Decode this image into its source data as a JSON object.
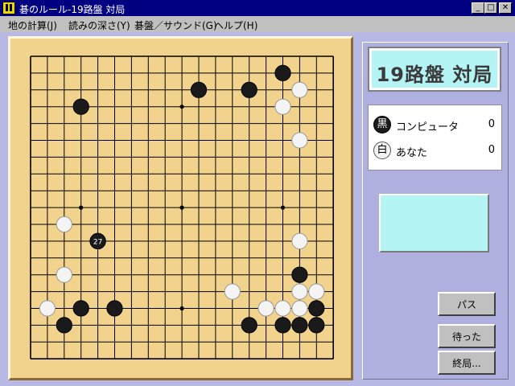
{
  "window": {
    "title": "碁のルール-19路盤 対局",
    "minimize_glyph": "_",
    "maximize_glyph": "□",
    "close_glyph": "✕"
  },
  "menu": [
    "地の計算(J)",
    "読みの深さ(Y)",
    "碁盤／サウンド(G)",
    "ヘルプ(H)"
  ],
  "panel": {
    "title": "19路盤 対局",
    "players": [
      {
        "stone": "黒",
        "color": "black",
        "name": "コンピュータ",
        "score": "0"
      },
      {
        "stone": "白",
        "color": "white",
        "name": "あなた",
        "score": "0"
      }
    ],
    "message": ""
  },
  "buttons": {
    "pass": "パス",
    "undo": "待った",
    "end": "終局..."
  },
  "board": {
    "size": 19,
    "hoshi": [
      [
        3,
        3
      ],
      [
        3,
        9
      ],
      [
        3,
        15
      ],
      [
        9,
        3
      ],
      [
        9,
        9
      ],
      [
        9,
        15
      ],
      [
        15,
        3
      ],
      [
        15,
        9
      ],
      [
        15,
        15
      ]
    ],
    "last_move": {
      "col": 4,
      "row": 11,
      "number": "27"
    },
    "black_stones": [
      [
        15,
        1
      ],
      [
        10,
        2
      ],
      [
        13,
        2
      ],
      [
        3,
        3
      ],
      [
        4,
        11
      ],
      [
        16,
        13
      ],
      [
        3,
        15
      ],
      [
        5,
        15
      ],
      [
        17,
        15
      ],
      [
        2,
        16
      ],
      [
        13,
        16
      ],
      [
        15,
        16
      ],
      [
        16,
        16
      ],
      [
        17,
        16
      ]
    ],
    "white_stones": [
      [
        16,
        2
      ],
      [
        15,
        3
      ],
      [
        16,
        5
      ],
      [
        2,
        10
      ],
      [
        16,
        11
      ],
      [
        2,
        13
      ],
      [
        12,
        14
      ],
      [
        16,
        14
      ],
      [
        17,
        14
      ],
      [
        1,
        15
      ],
      [
        14,
        15
      ],
      [
        15,
        15
      ],
      [
        16,
        15
      ]
    ],
    "colors": {
      "wood": "#f2d38e",
      "line": "#000000",
      "black": "#1a1a1a",
      "white": "#f4f4f4"
    }
  }
}
